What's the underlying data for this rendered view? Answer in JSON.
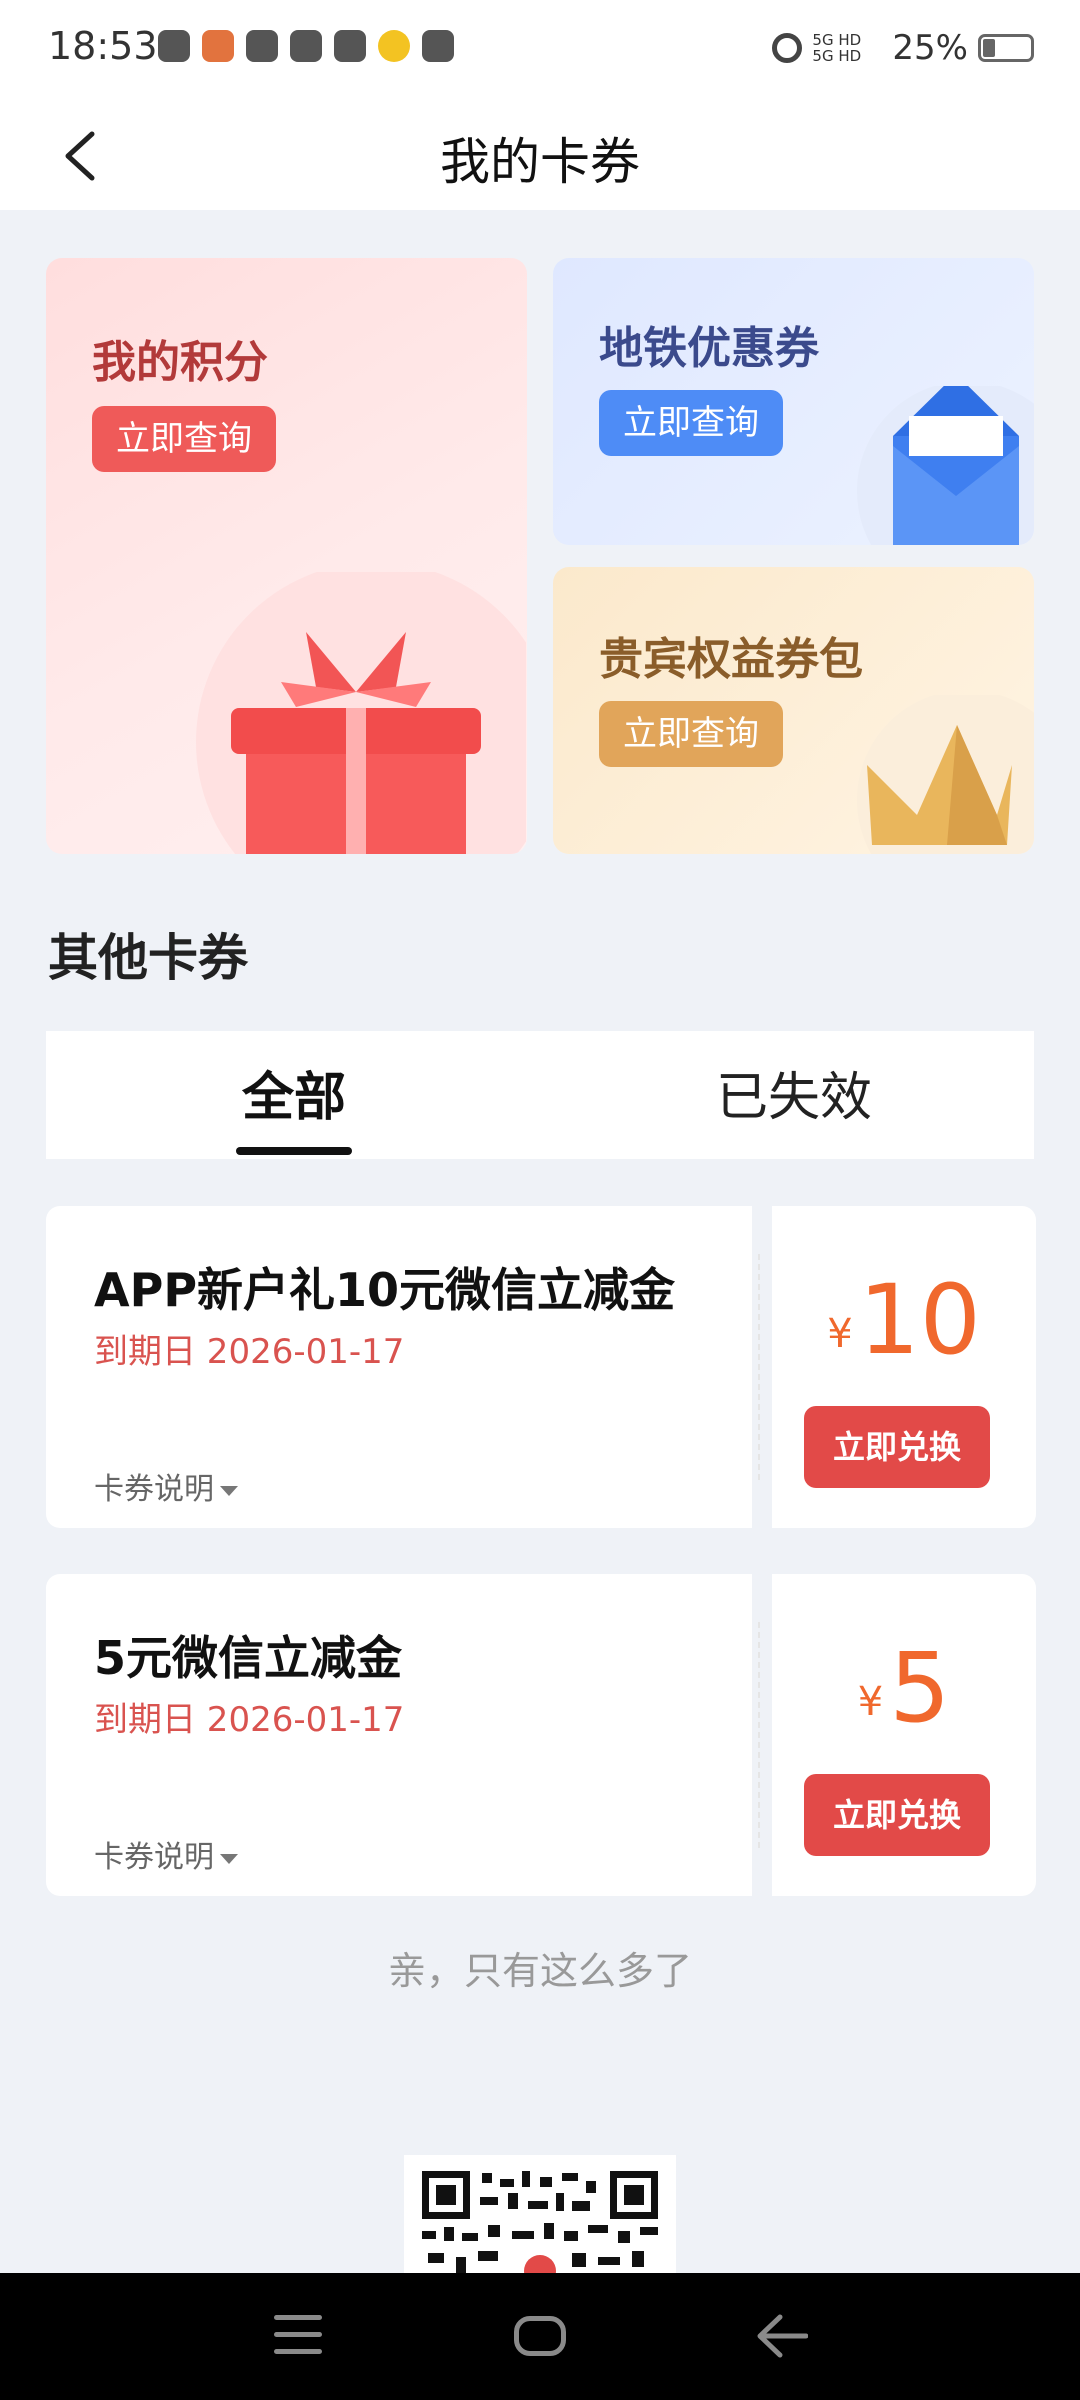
{
  "status_bar": {
    "time": "18:53",
    "network": "5G HD 5G HD",
    "battery": "25%"
  },
  "header": {
    "title": "我的卡券"
  },
  "cards": {
    "points": {
      "title": "我的积分",
      "button": "立即查询"
    },
    "metro": {
      "title": "地铁优惠券",
      "button": "立即查询"
    },
    "vip": {
      "title": "贵宾权益券包",
      "button": "立即查询"
    }
  },
  "section": {
    "title": "其他卡券"
  },
  "tabs": [
    {
      "label": "全部",
      "active": true
    },
    {
      "label": "已失效",
      "active": false
    }
  ],
  "coupons": [
    {
      "name": "APP新户礼10元微信立减金",
      "expiry": "到期日 2026-01-17",
      "desc": "卡券说明",
      "currency": "¥",
      "amount": "10",
      "button": "立即兑换"
    },
    {
      "name": "5元微信立减金",
      "expiry": "到期日 2026-01-17",
      "desc": "卡券说明",
      "currency": "¥",
      "amount": "5",
      "button": "立即兑换"
    }
  ],
  "footer": {
    "end_text": "亲，只有这么多了"
  },
  "colors": {
    "accent": "#e24a48",
    "amount": "#f0682d",
    "background": "#eff2f7"
  }
}
